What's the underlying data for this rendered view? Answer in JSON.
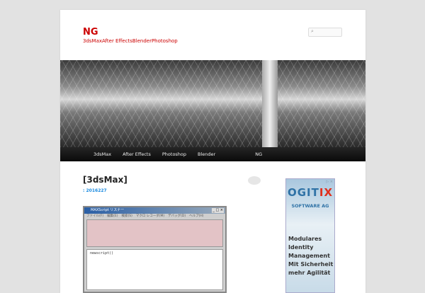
{
  "site": {
    "title": "NG",
    "description": "3dsMaxAfter EffectsBlenderPhotoshop",
    "search_placeholder": ""
  },
  "nav": [
    "3dsMax",
    "After Effects",
    "Photoshop",
    "Blender",
    "NG"
  ],
  "post": {
    "title": "[3dsMax]",
    "date_prefix": ": ",
    "date": "2016227"
  },
  "maxscript": {
    "title": "MAXScript リスナー",
    "menu": [
      "ファイル(F)",
      "編集(E)",
      "検索(S)",
      "マクロ レコーダ(M)",
      "デバッグ(D)",
      "ヘルプ(H)"
    ],
    "window_controls": "_ □ ×",
    "input": "newscript()"
  },
  "ad": {
    "logo_a": "OGIT",
    "logo_b": "IX",
    "subtitle": "SOFTWARE AG",
    "lines": [
      "Modulares",
      "Identity",
      "Management",
      "Mit Sicherheit",
      "mehr Agilität"
    ],
    "close": "▷ ×"
  }
}
